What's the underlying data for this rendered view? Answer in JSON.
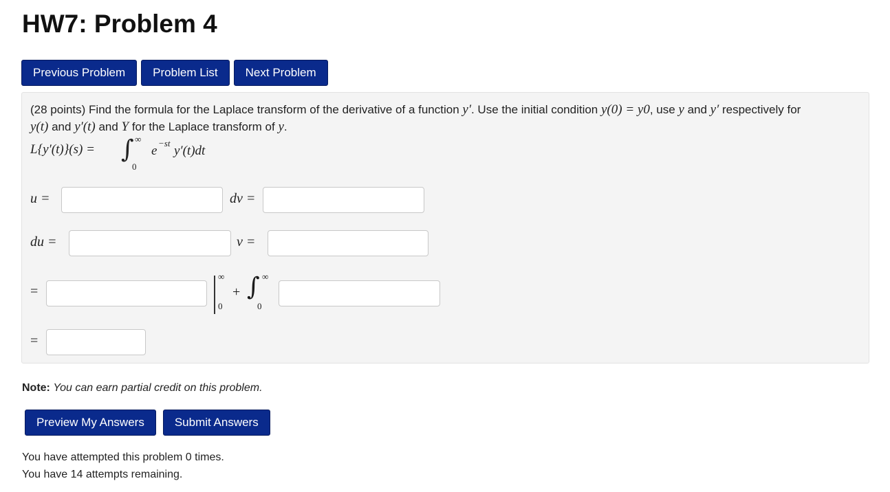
{
  "page": {
    "title": "HW7: Problem 4"
  },
  "nav": {
    "previous_label": "Previous Problem",
    "list_label": "Problem List",
    "next_label": "Next Problem"
  },
  "problem": {
    "intro": "(28 points) Find the formula for the Laplace transform of the derivative of a function ",
    "yprime": "y′",
    "p2": ". Use the initial condition ",
    "ic": "y(0) = y0",
    "p3": ", use ",
    "y": "y",
    "and1": " and ",
    "yprime2": "y′",
    "p4": " respectively for",
    "yt": "y(t)",
    "and2": " and ",
    "ypt": "y′(t)",
    "and3": " and ",
    "Y": "Y",
    "p5": " for the Laplace transform of ",
    "y2": "y",
    "period": ".",
    "formula": {
      "lhs": "L{y′(t)}(s) =",
      "integral_sign": "∫",
      "upper": "∞",
      "lower": "0",
      "integrand_e": "e",
      "exponent": "−st",
      "integrand_rest": "y′(t)dt"
    },
    "labels": {
      "u": "u =",
      "dv": "dv =",
      "du": "du =",
      "v": "v =",
      "eq1": "=",
      "eq2": "=",
      "bar_upper": "∞",
      "bar_lower": "0",
      "plus": "+",
      "int2_sign": "∫",
      "int2_upper": "∞",
      "int2_lower": "0"
    },
    "answers": {
      "u": "",
      "dv": "",
      "du": "",
      "v": "",
      "eval_term": "",
      "int_term": "",
      "final": ""
    }
  },
  "note": {
    "label": "Note:",
    "text": "You can earn partial credit on this problem."
  },
  "actions": {
    "preview_label": "Preview My Answers",
    "submit_label": "Submit Answers"
  },
  "status": {
    "attempts": "You have attempted this problem 0 times.",
    "remaining": "You have 14 attempts remaining."
  }
}
